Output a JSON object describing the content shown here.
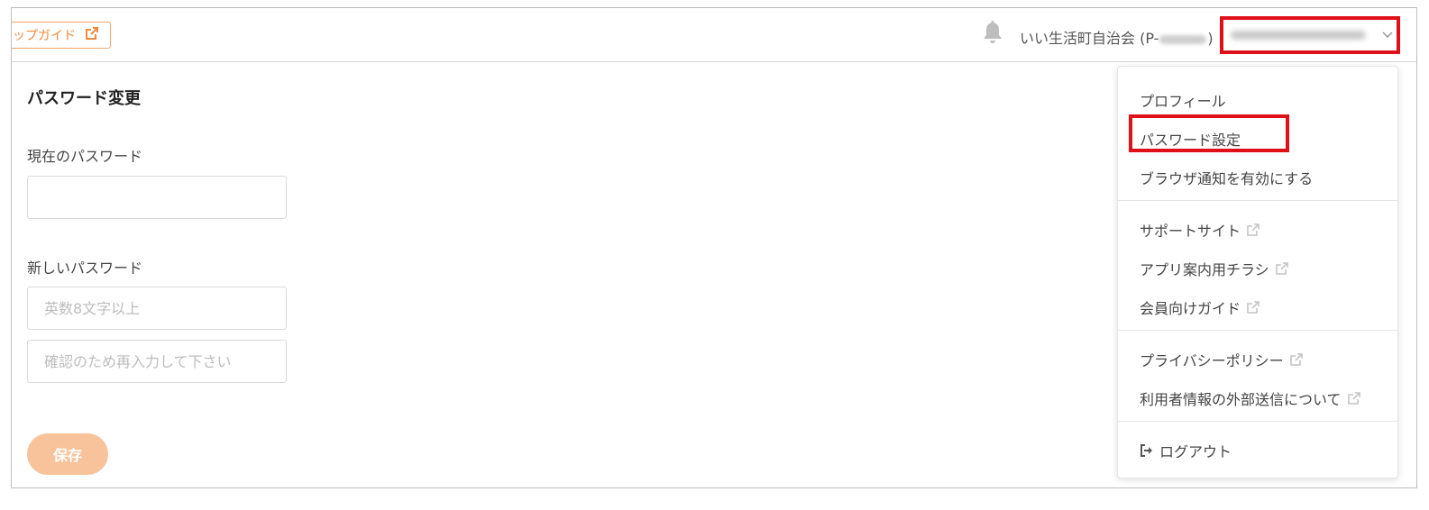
{
  "header": {
    "guide_label": "ップガイド",
    "organization_prefix": "いい生活町自治会 (P-",
    "organization_suffix": ")"
  },
  "main": {
    "title": "パスワード変更",
    "current_password_label": "現在のパスワード",
    "new_password_label": "新しいパスワード",
    "new_password_placeholder": "英数8文字以上",
    "confirm_password_placeholder": "確認のため再入力して下さい",
    "save_label": "保存"
  },
  "menu": {
    "profile": "プロフィール",
    "password_settings": "パスワード設定",
    "browser_notifications": "ブラウザ通知を有効にする",
    "support_site": "サポートサイト",
    "app_flyer": "アプリ案内用チラシ",
    "member_guide": "会員向けガイド",
    "privacy_policy": "プライバシーポリシー",
    "external_transmission": "利用者情報の外部送信について",
    "logout": "ログアウト"
  },
  "colors": {
    "accent": "#f28a3c",
    "save_button": "#f8c29a",
    "highlight": "#e0101a"
  },
  "icons": {
    "guide": "external-link-icon",
    "notifications": "bell-icon",
    "dropdown": "chevron-down-icon",
    "logout": "logout-icon"
  }
}
